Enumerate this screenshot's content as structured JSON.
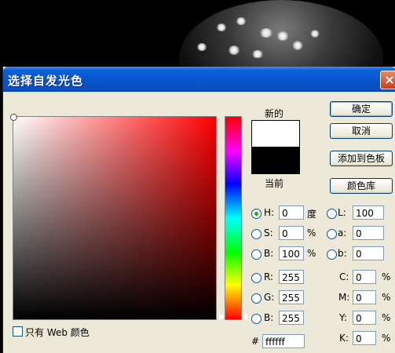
{
  "dialog": {
    "title": "选择自发光色",
    "close_glyph": "×",
    "new_label": "新的",
    "current_label": "当前",
    "new_color": "#ffffff",
    "current_color": "#000000",
    "buttons": {
      "ok": "确定",
      "cancel": "取消",
      "add_swatch": "添加到色板",
      "color_library": "颜色库"
    },
    "hsb": {
      "h": {
        "label": "H:",
        "value": "0",
        "unit": "度",
        "selected": true
      },
      "s": {
        "label": "S:",
        "value": "0",
        "unit": "%"
      },
      "b": {
        "label": "B:",
        "value": "100",
        "unit": "%"
      }
    },
    "lab": {
      "l": {
        "label": "L:",
        "value": "100"
      },
      "a": {
        "label": "a:",
        "value": "0"
      },
      "b": {
        "label": "b:",
        "value": "0"
      }
    },
    "rgb": {
      "r": {
        "label": "R:",
        "value": "255"
      },
      "g": {
        "label": "G:",
        "value": "255"
      },
      "b": {
        "label": "B:",
        "value": "255"
      }
    },
    "cmyk": {
      "c": {
        "label": "C:",
        "value": "0",
        "unit": "%"
      },
      "m": {
        "label": "M:",
        "value": "0",
        "unit": "%"
      },
      "y": {
        "label": "Y:",
        "value": "0",
        "unit": "%"
      },
      "k": {
        "label": "K:",
        "value": "0",
        "unit": "%"
      }
    },
    "hex": {
      "label": "#",
      "value": "ffffff"
    },
    "web_only_label": "只有 Web 颜色",
    "hue_color": "#ff0000"
  }
}
